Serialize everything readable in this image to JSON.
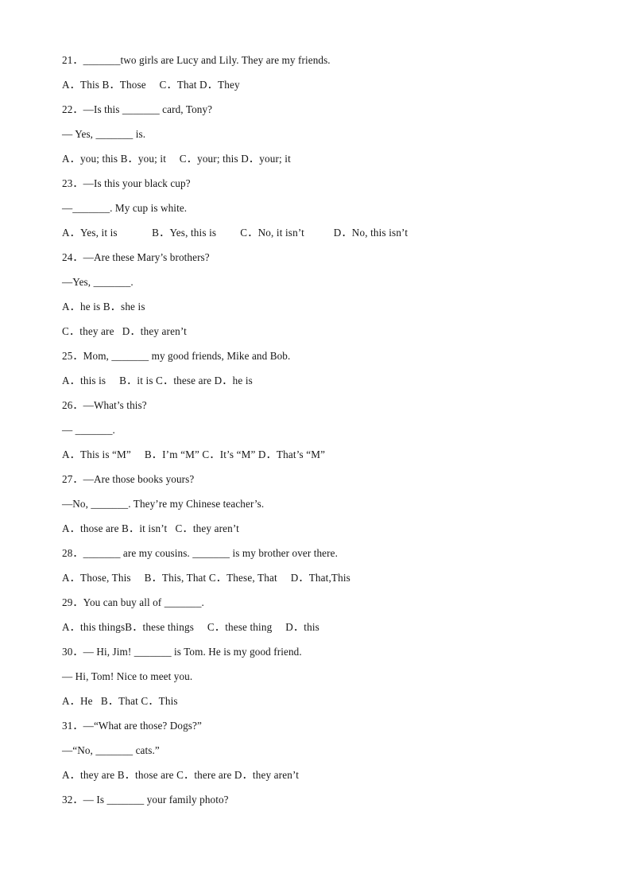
{
  "document": {
    "type": "english-grammar-worksheet",
    "page_background": "#ffffff",
    "text_color": "#161616",
    "lines": [
      {
        "id": "q21-stem",
        "kind": "question",
        "number": "21",
        "text": "21．_______two girls are Lucy and Lily. They are my friends."
      },
      {
        "id": "q21-opts",
        "kind": "options",
        "text": "A．This B．Those  C．That D．They"
      },
      {
        "id": "q22-stem",
        "kind": "question",
        "number": "22",
        "text": "22．—Is this _______ card, Tony?"
      },
      {
        "id": "q22-reply",
        "kind": "dialogue",
        "text": "— Yes, _______ is."
      },
      {
        "id": "q22-opts",
        "kind": "options",
        "text": "A．you; this B．you; it  C．your; this D．your; it"
      },
      {
        "id": "q23-stem",
        "kind": "question",
        "number": "23",
        "text": "23．—Is this your black cup?"
      },
      {
        "id": "q23-reply",
        "kind": "dialogue",
        "text": "—_______. My cup is white."
      },
      {
        "id": "q23-opts",
        "kind": "options",
        "text": "A．Yes, it is    B．Yes, this is   C．No, it isn’t    D．No, this isn’t"
      },
      {
        "id": "q24-stem",
        "kind": "question",
        "number": "24",
        "text": "24．—Are these Mary’s brothers?"
      },
      {
        "id": "q24-reply",
        "kind": "dialogue",
        "text": "—Yes, _______."
      },
      {
        "id": "q24-opts-ab",
        "kind": "options",
        "text": "A．he is B．she is"
      },
      {
        "id": "q24-opts-cd",
        "kind": "options",
        "text": "C．they are  D．they aren’t"
      },
      {
        "id": "q25-stem",
        "kind": "question",
        "number": "25",
        "text": "25．Mom, _______ my good friends, Mike and Bob."
      },
      {
        "id": "q25-opts",
        "kind": "options",
        "text": "A．this is   B．it is C．these are D．he is"
      },
      {
        "id": "q26-stem",
        "kind": "question",
        "number": "26",
        "text": "26．—What’s this?"
      },
      {
        "id": "q26-reply",
        "kind": "dialogue",
        "text": "— _______."
      },
      {
        "id": "q26-opts",
        "kind": "options",
        "text": "A．This is “M”   B．I’m “M” C．It’s “M” D．That’s “M”"
      },
      {
        "id": "q27-stem",
        "kind": "question",
        "number": "27",
        "text": "27．—Are those books yours?"
      },
      {
        "id": "q27-reply",
        "kind": "dialogue",
        "text": "—No, _______. They’re my Chinese teacher’s."
      },
      {
        "id": "q27-opts",
        "kind": "options",
        "text": "A．those are B．it isn’t  C．they aren’t"
      },
      {
        "id": "q28-stem",
        "kind": "question",
        "number": "28",
        "text": "28．_______ are my cousins. _______ is my brother over there."
      },
      {
        "id": "q28-opts",
        "kind": "options",
        "text": "A．Those, This   B．This, That C．These, That   D．That,This"
      },
      {
        "id": "q29-stem",
        "kind": "question",
        "number": "29",
        "text": "29．You can buy all of _______."
      },
      {
        "id": "q29-opts",
        "kind": "options",
        "text": "A．this thingsB．these things   C．these thing   D．this"
      },
      {
        "id": "q30-stem",
        "kind": "question",
        "number": "30",
        "text": "30．— Hi, Jim! _______ is Tom. He is my good friend."
      },
      {
        "id": "q30-reply",
        "kind": "dialogue",
        "text": "— Hi, Tom! Nice to meet you."
      },
      {
        "id": "q30-opts",
        "kind": "options",
        "text": "A．He  B．That C．This"
      },
      {
        "id": "q31-stem",
        "kind": "question",
        "number": "31",
        "text": "31．—“What are those? Dogs?”"
      },
      {
        "id": "q31-reply",
        "kind": "dialogue",
        "text": "—“No, _______ cats.”"
      },
      {
        "id": "q31-opts",
        "kind": "options",
        "text": "A．they are B．those are C．there are D．they aren’t"
      },
      {
        "id": "q32-stem",
        "kind": "question",
        "number": "32",
        "text": "32．— Is _______ your family photo?"
      }
    ]
  }
}
